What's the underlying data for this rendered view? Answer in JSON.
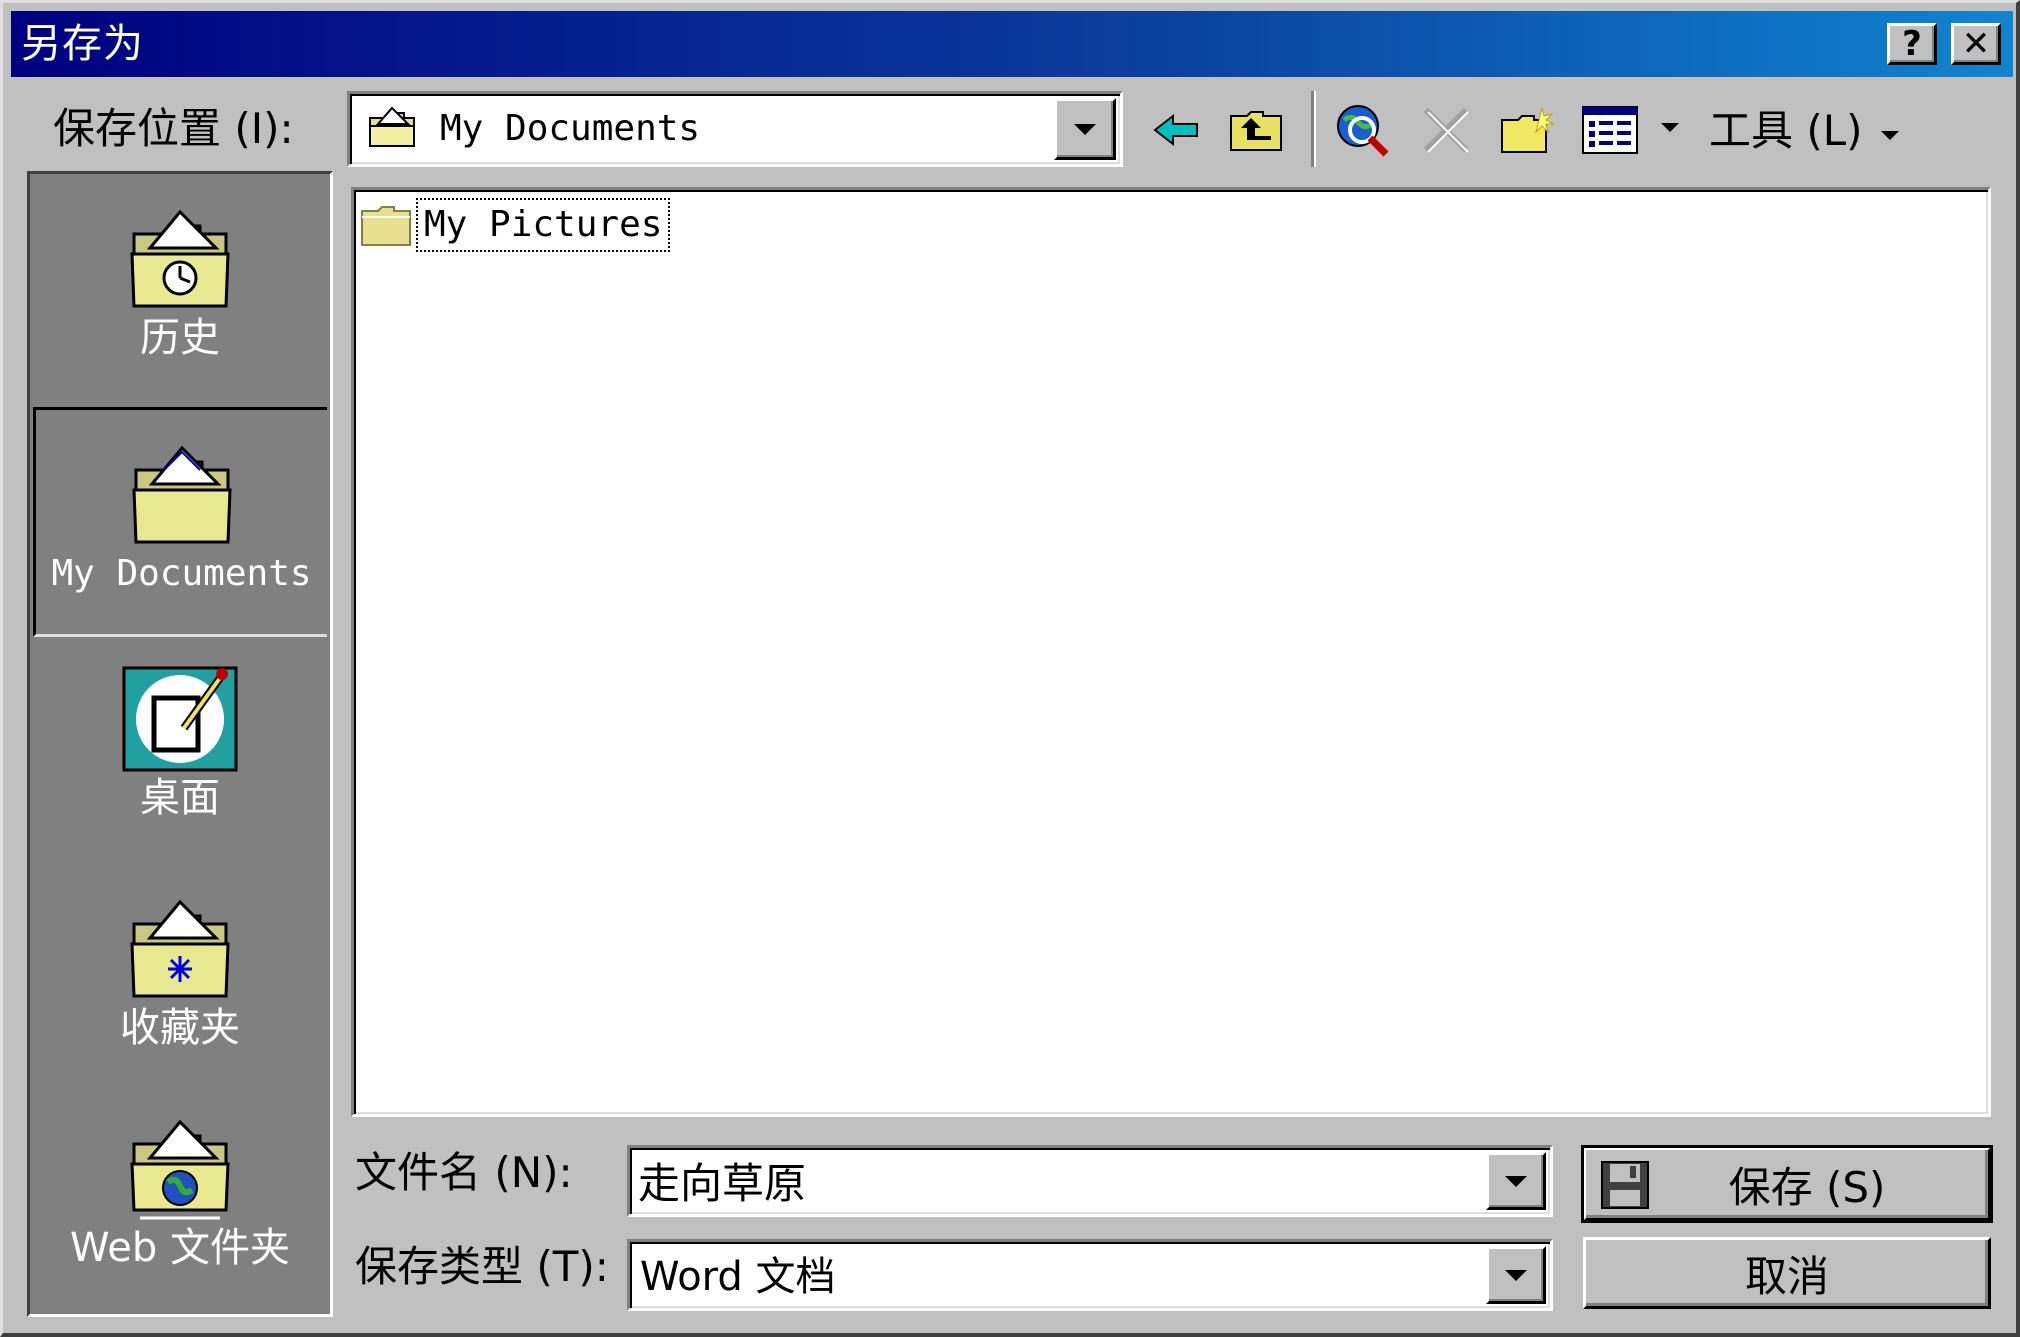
{
  "window": {
    "title": "另存为",
    "help_label": "?",
    "close_label": "✕"
  },
  "location": {
    "label": "保存位置 (I):",
    "value": "My Documents"
  },
  "toolbar": {
    "tools_label": "工具 (L)"
  },
  "places": [
    {
      "label": "历史",
      "icon": "history-folder-icon"
    },
    {
      "label": "My Documents",
      "icon": "my-documents-folder-icon"
    },
    {
      "label": "桌面",
      "icon": "desktop-icon"
    },
    {
      "label": "收藏夹",
      "icon": "favorites-folder-icon"
    },
    {
      "label": "Web 文件夹",
      "icon": "web-folder-icon"
    }
  ],
  "files": [
    {
      "name": "My Pictures",
      "type": "folder"
    }
  ],
  "filename": {
    "label": "文件名 (N):",
    "value": "走向草原"
  },
  "filetype": {
    "label": "保存类型 (T):",
    "value": "Word 文档"
  },
  "buttons": {
    "save": "保存 (S)",
    "cancel": "取消"
  },
  "colors": {
    "title_start": "#000080",
    "title_end": "#1084d0",
    "face": "#c0c0c0",
    "places_bg": "#808080"
  }
}
